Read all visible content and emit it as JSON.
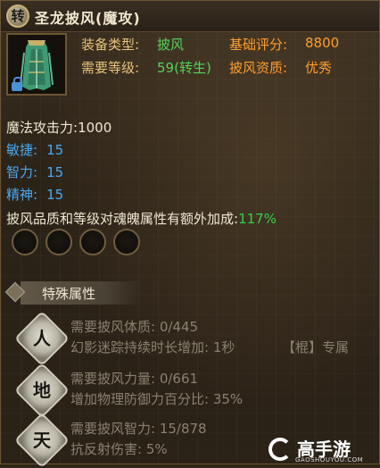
{
  "item": {
    "badge": "转",
    "name": "圣龙披风(魔攻)",
    "icon": "green-cloak-icon"
  },
  "info": {
    "equip_type_label": "装备类型:",
    "equip_type_value": "披风",
    "score_label": "基础评分:",
    "score_value": "8800",
    "level_label": "需要等级:",
    "level_value": "59(转生)",
    "quality_label": "披风资质:",
    "quality_value": "优秀"
  },
  "stats": [
    {
      "label": "魔法攻击力:",
      "value": "1000"
    },
    {
      "label": "敏捷:",
      "value": "15"
    },
    {
      "label": "智力:",
      "value": "15"
    },
    {
      "label": "精神:",
      "value": "15"
    }
  ],
  "bonus": {
    "text": "披风品质和等级对魂魄属性有额外加成:",
    "value": "117%"
  },
  "sockets": 4,
  "special": {
    "title": "特殊属性",
    "items": [
      {
        "badge": "人",
        "req": "需要披风体质: 0/445",
        "effect": "幻影迷踪持续时长增加: 1秒",
        "tag": "【棍】专属"
      },
      {
        "badge": "地",
        "req": "需要披风力量: 0/661",
        "effect": "增加物理防御力百分比: 35%",
        "tag": ""
      },
      {
        "badge": "天",
        "req": "需要披风智力: 15/878",
        "effect": "抗反射伤害: 5%",
        "tag": ""
      }
    ]
  },
  "watermark": {
    "name": "高手游",
    "url": "GAOSHOUYOU.COM"
  },
  "colors": {
    "label_gold": "#e8c37a",
    "value_green": "#53d458",
    "label_orange": "#ff9d2f",
    "stat_blue": "#4aa9f0",
    "percent_green": "#2fd24a"
  }
}
